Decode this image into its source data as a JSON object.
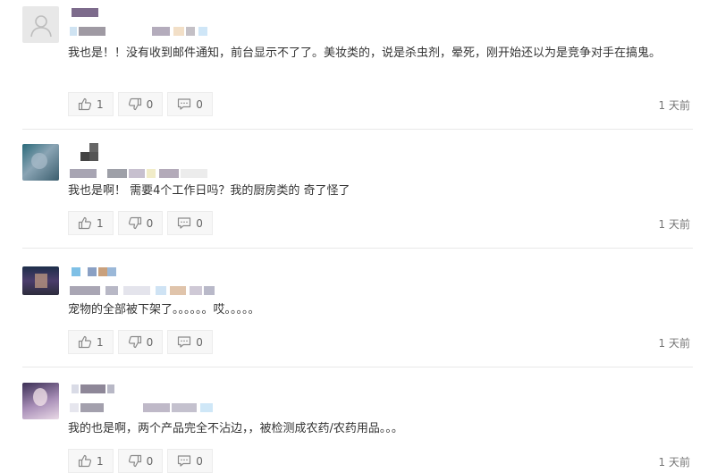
{
  "comments": [
    {
      "text": "我也是！！没有收到邮件通知，前台显示不了了。美妆类的，说是杀虫剂，晕死，刚开始还以为是竞争对手在搞鬼。",
      "like_count": "1",
      "dislike_count": "0",
      "reply_count": "0",
      "time": "1 天前"
    },
    {
      "text": "我也是啊！ 需要4个工作日吗？我的厨房类的 奇了怪了",
      "like_count": "1",
      "dislike_count": "0",
      "reply_count": "0",
      "time": "1 天前"
    },
    {
      "text": "宠物的全部被下架了。。。。。。哎。。。。。",
      "like_count": "1",
      "dislike_count": "0",
      "reply_count": "0",
      "time": "1 天前"
    },
    {
      "text": "我的也是啊，两个产品完全不沾边，，被检测成农药/农药用品。。。",
      "like_count": "1",
      "dislike_count": "0",
      "reply_count": "0",
      "time": "1 天前"
    }
  ],
  "icons": {
    "like": "thumbs-up-icon",
    "dislike": "thumbs-down-icon",
    "reply": "speech-bubble-icon",
    "default_avatar": "user-silhouette-icon"
  },
  "colors": {
    "button_bg": "#f7f7f7",
    "separator": "#e9e9e9",
    "text": "#333333",
    "muted": "#777777"
  }
}
